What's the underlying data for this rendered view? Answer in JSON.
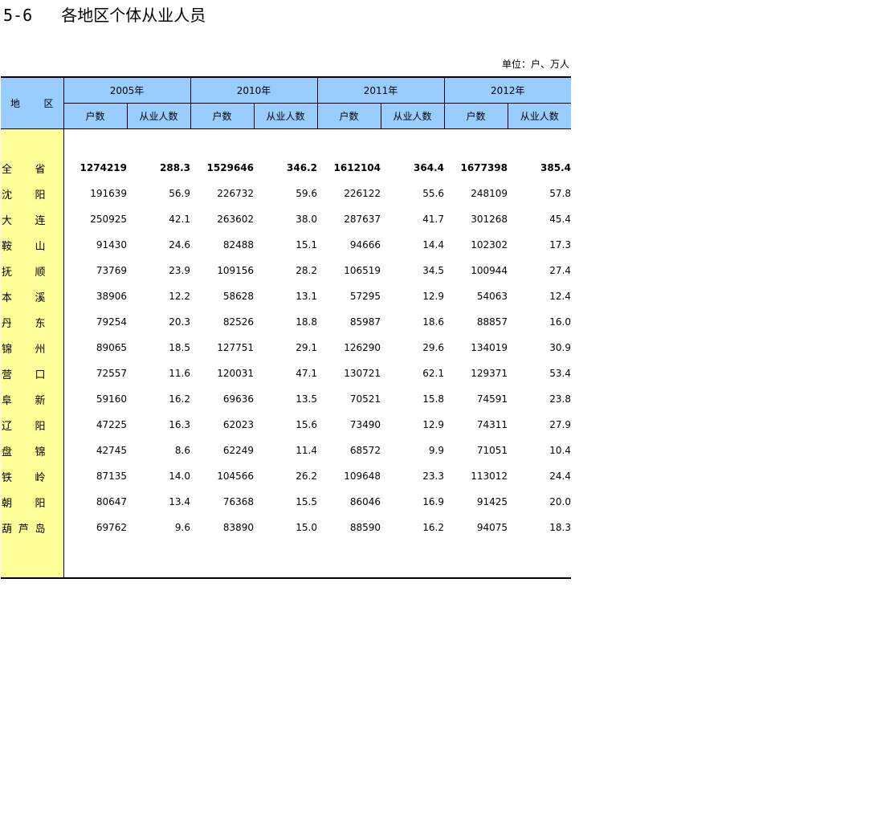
{
  "title": "5-6   各地区个体从业人员",
  "unit": "单位：户、万人",
  "header": {
    "region": "地区",
    "years": [
      "2005年",
      "2010年",
      "2011年",
      "2012年"
    ],
    "sub_households": "户数",
    "sub_workers": "从业人数"
  },
  "rows": [
    {
      "region": "全省",
      "values": [
        "1274219",
        "288.3",
        "1529646",
        "346.2",
        "1612104",
        "364.4",
        "1677398",
        "385.4"
      ],
      "bold": true
    },
    {
      "region": "沈阳",
      "values": [
        "191639",
        "56.9",
        "226732",
        "59.6",
        "226122",
        "55.6",
        "248109",
        "57.8"
      ]
    },
    {
      "region": "大连",
      "values": [
        "250925",
        "42.1",
        "263602",
        "38.0",
        "287637",
        "41.7",
        "301268",
        "45.4"
      ]
    },
    {
      "region": "鞍山",
      "values": [
        "91430",
        "24.6",
        "82488",
        "15.1",
        "94666",
        "14.4",
        "102302",
        "17.3"
      ]
    },
    {
      "region": "抚顺",
      "values": [
        "73769",
        "23.9",
        "109156",
        "28.2",
        "106519",
        "34.5",
        "100944",
        "27.4"
      ]
    },
    {
      "region": "本溪",
      "values": [
        "38906",
        "12.2",
        "58628",
        "13.1",
        "57295",
        "12.9",
        "54063",
        "12.4"
      ]
    },
    {
      "region": "丹东",
      "values": [
        "79254",
        "20.3",
        "82526",
        "18.8",
        "85987",
        "18.6",
        "88857",
        "16.0"
      ]
    },
    {
      "region": "锦州",
      "values": [
        "89065",
        "18.5",
        "127751",
        "29.1",
        "126290",
        "29.6",
        "134019",
        "30.9"
      ]
    },
    {
      "region": "营口",
      "values": [
        "72557",
        "11.6",
        "120031",
        "47.1",
        "130721",
        "62.1",
        "129371",
        "53.4"
      ]
    },
    {
      "region": "阜新",
      "values": [
        "59160",
        "16.2",
        "69636",
        "13.5",
        "70521",
        "15.8",
        "74591",
        "23.8"
      ]
    },
    {
      "region": "辽阳",
      "values": [
        "47225",
        "16.3",
        "62023",
        "15.6",
        "73490",
        "12.9",
        "74311",
        "27.9"
      ]
    },
    {
      "region": "盘锦",
      "values": [
        "42745",
        "8.6",
        "62249",
        "11.4",
        "68572",
        "9.9",
        "71051",
        "10.4"
      ]
    },
    {
      "region": "铁岭",
      "values": [
        "87135",
        "14.0",
        "104566",
        "26.2",
        "109648",
        "23.3",
        "113012",
        "24.4"
      ]
    },
    {
      "region": "朝阳",
      "values": [
        "80647",
        "13.4",
        "76368",
        "15.5",
        "86046",
        "16.9",
        "91425",
        "20.0"
      ]
    },
    {
      "region": "葫芦岛",
      "values": [
        "69762",
        "9.6",
        "83890",
        "15.0",
        "88590",
        "16.2",
        "94075",
        "18.3"
      ]
    }
  ]
}
